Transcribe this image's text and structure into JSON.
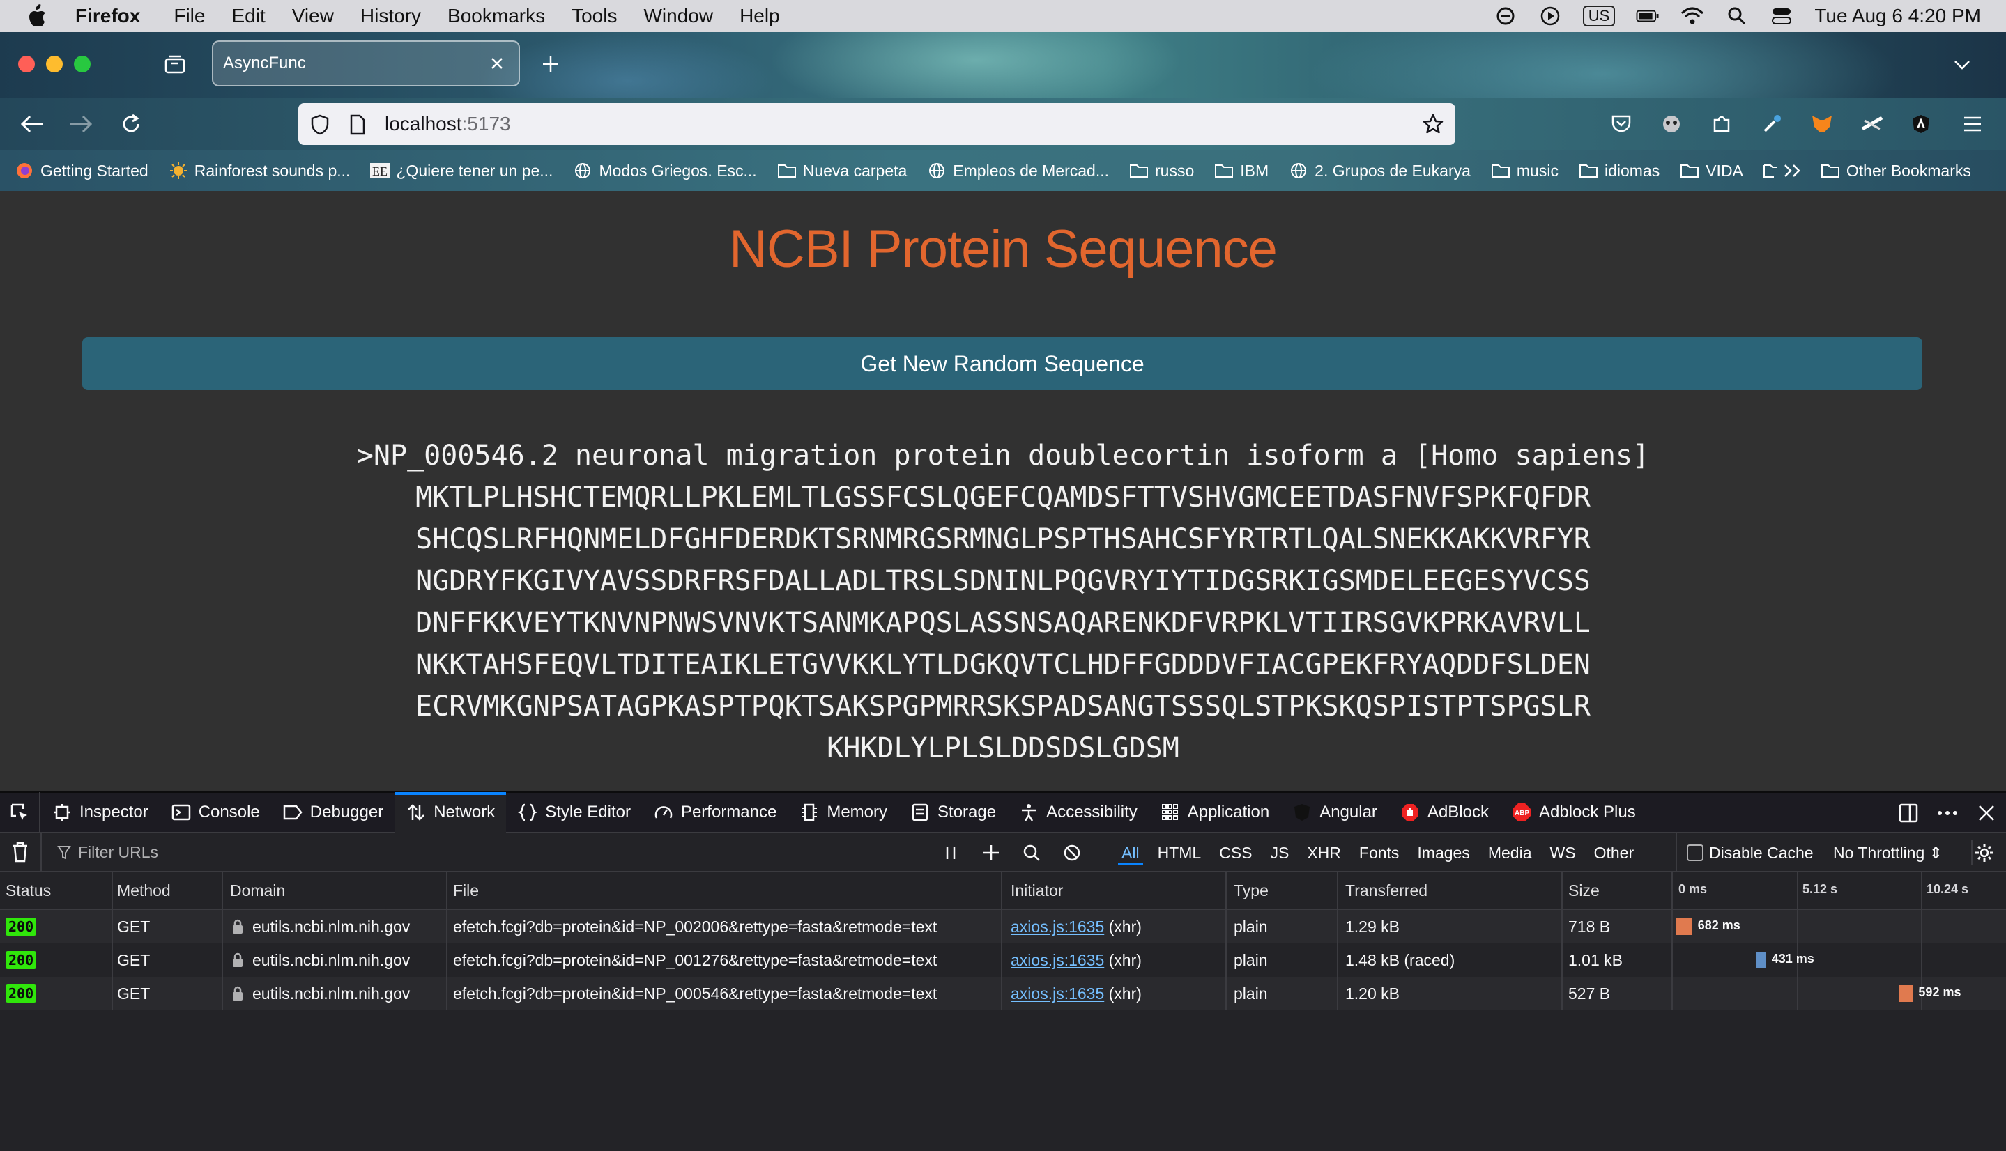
{
  "menubar": {
    "app": "Firefox",
    "items": [
      "File",
      "Edit",
      "View",
      "History",
      "Bookmarks",
      "Tools",
      "Window",
      "Help"
    ],
    "input_source": "US",
    "datetime": "Tue Aug 6  4:20 PM"
  },
  "tab": {
    "title": "AsyncFunc"
  },
  "urlbar": {
    "host": "localhost",
    "port": ":5173"
  },
  "bookmarks": [
    {
      "label": "Getting Started",
      "icon": "firefox-icon"
    },
    {
      "label": "Rainforest sounds p...",
      "icon": "sun-icon"
    },
    {
      "label": "¿Quiere tener un pe...",
      "icon": "ee-logo-icon"
    },
    {
      "label": "Modos Griegos. Esc...",
      "icon": "globe-icon"
    },
    {
      "label": "Nueva carpeta",
      "icon": "folder-icon"
    },
    {
      "label": "Empleos de Mercad...",
      "icon": "globe-icon"
    },
    {
      "label": "russo",
      "icon": "folder-icon"
    },
    {
      "label": "IBM",
      "icon": "folder-icon"
    },
    {
      "label": "2. Grupos de Eukarya",
      "icon": "globe-icon"
    },
    {
      "label": "music",
      "icon": "folder-icon"
    },
    {
      "label": "idiomas",
      "icon": "folder-icon"
    },
    {
      "label": "VIDA",
      "icon": "folder-icon"
    }
  ],
  "other_bookmarks": "Other Bookmarks",
  "page": {
    "title": "NCBI Protein Sequence",
    "button": "Get New Random Sequence",
    "sequence_lines": [
      ">NP_000546.2 neuronal migration protein doublecortin isoform a [Homo sapiens]",
      "MKTLPLHSHCTEMQRLLPKLEMLTLGSSFCSLQGEFCQAMDSFTTVSHVGMCEETDASFNVFSPKFQFDR",
      "SHCQSLRFHQNMELDFGHFDERDKTSRNMRGSRMNGLPSPTHSAHCSFYRTRTLQALSNEKKAKKVRFYR",
      "NGDRYFKGIVYAVSSDRFRSFDALLADLTRSLSDNINLPQGVRYIYTIDGSRKIGSMDELEEGESYVCSS",
      "DNFFKKVEYTKNVNPNWSVNVKTSANMKAPQSLASSNSAQARENKDFVRPKLVTIIRSGVKPRKAVRVLL",
      "NKKTAHSFEQVLTDITEAIKLETGVVKKLYTLDGKQVTCLHDFFGDDDVFIACGPEKFRYAQDDFSLDEN",
      "ECRVMKGNPSATAGPKASPTPQKTSAKSPGPMRRSKSPADSANGTSSSQLSTPKSKQSPISTPTSPGSLR",
      "KHKDLYLPLSLDDSDSLGDSM"
    ]
  },
  "devtools": {
    "tabs": [
      "Inspector",
      "Console",
      "Debugger",
      "Network",
      "Style Editor",
      "Performance",
      "Memory",
      "Storage",
      "Accessibility",
      "Application",
      "Angular",
      "AdBlock",
      "Adblock Plus"
    ],
    "active_tab": "Network",
    "filter_placeholder": "Filter URLs",
    "type_filters": [
      "All",
      "HTML",
      "CSS",
      "JS",
      "XHR",
      "Fonts",
      "Images",
      "Media",
      "WS",
      "Other"
    ],
    "disable_cache": "Disable Cache",
    "throttling": "No Throttling ⇕",
    "columns": [
      "Status",
      "Method",
      "Domain",
      "File",
      "Initiator",
      "Type",
      "Transferred",
      "Size"
    ],
    "waterfall_ticks": [
      "0 ms",
      "5.12 s",
      "10.24 s"
    ],
    "requests": [
      {
        "status": "200",
        "method": "GET",
        "domain": "eutils.ncbi.nlm.nih.gov",
        "file": "efetch.fcgi?db=protein&id=NP_002006&rettype=fasta&retmode=text",
        "initiator": "axios.js:1635",
        "initiator_suffix": "(xhr)",
        "type": "plain",
        "transferred": "1.29 kB",
        "size": "718 B",
        "time_label": "682 ms",
        "start_s": 0.0,
        "duration_ms": 682,
        "bar_color": "#e07a4f"
      },
      {
        "status": "200",
        "method": "GET",
        "domain": "eutils.ncbi.nlm.nih.gov",
        "file": "efetch.fcgi?db=protein&id=NP_001276&rettype=fasta&retmode=text",
        "initiator": "axios.js:1635",
        "initiator_suffix": "(xhr)",
        "type": "plain",
        "transferred": "1.48 kB (raced)",
        "size": "1.01 kB",
        "time_label": "431 ms",
        "start_s": 3.3,
        "duration_ms": 431,
        "bar_color": "#5f8fc7"
      },
      {
        "status": "200",
        "method": "GET",
        "domain": "eutils.ncbi.nlm.nih.gov",
        "file": "efetch.fcgi?db=protein&id=NP_000546&rettype=fasta&retmode=text",
        "initiator": "axios.js:1635",
        "initiator_suffix": "(xhr)",
        "type": "plain",
        "transferred": "1.20 kB",
        "size": "527 B",
        "time_label": "592 ms",
        "start_s": 9.2,
        "duration_ms": 592,
        "bar_color": "#e07a4f"
      }
    ]
  }
}
